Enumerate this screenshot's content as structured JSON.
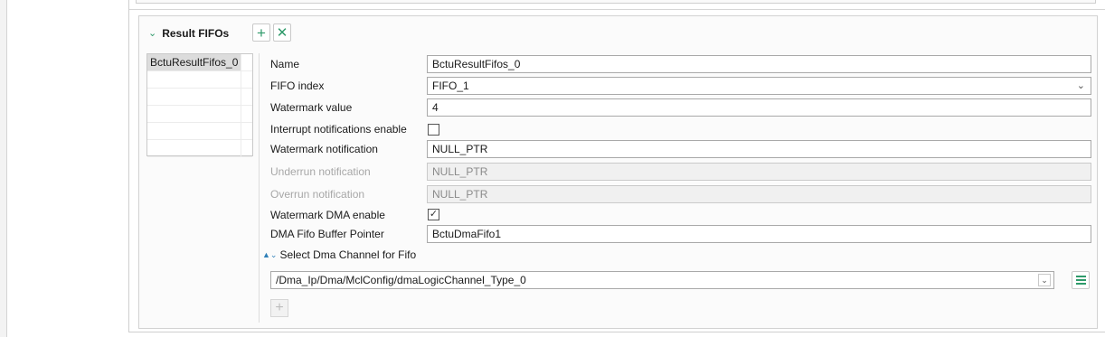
{
  "section": {
    "title": "Result FIFOs",
    "add_icon": "plus-icon",
    "delete_icon": "x-icon"
  },
  "list": {
    "items": [
      "BctuResultFifos_0",
      "",
      "",
      "",
      "",
      ""
    ]
  },
  "form": {
    "name": {
      "label": "Name",
      "value": "BctuResultFifos_0"
    },
    "fifo_index": {
      "label": "FIFO index",
      "value": "FIFO_1"
    },
    "watermark_value": {
      "label": "Watermark value",
      "value": "4"
    },
    "interrupt_enable": {
      "label": "Interrupt notifications enable",
      "checked": false
    },
    "watermark_notification": {
      "label": "Watermark notification",
      "value": "NULL_PTR"
    },
    "underrun_notification": {
      "label": "Underrun notification",
      "value": "NULL_PTR"
    },
    "overrun_notification": {
      "label": "Overrun notification",
      "value": "NULL_PTR"
    },
    "watermark_dma_enable": {
      "label": "Watermark DMA enable",
      "checked": true,
      "mark": "✓"
    },
    "dma_fifo_buffer_pointer": {
      "label": "DMA Fifo Buffer Pointer",
      "value": "BctuDmaFifo1"
    }
  },
  "dma_channel": {
    "label": "Select Dma Channel for Fifo",
    "value": "/Dma_Ip/Dma/MclConfig/dmaLogicChannel_Type_0"
  },
  "colors": {
    "accent_green": "#2e9a6a",
    "link_blue": "#2e7fb8"
  }
}
